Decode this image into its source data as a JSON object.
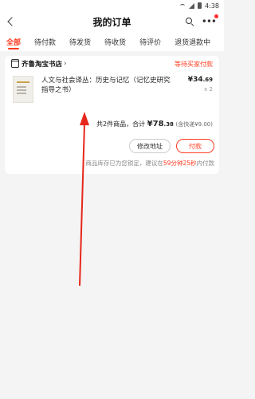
{
  "status_bar": {
    "time": "4:38"
  },
  "nav": {
    "title": "我的订单"
  },
  "tabs": [
    {
      "label": "全部",
      "active": true
    },
    {
      "label": "待付款"
    },
    {
      "label": "待发货"
    },
    {
      "label": "待收货"
    },
    {
      "label": "待评价"
    },
    {
      "label": "退货退款中"
    }
  ],
  "order": {
    "shop_name": "齐鲁淘宝书店",
    "status": "等待买家付款",
    "item": {
      "title": "人文与社会译丛：历史与记忆（记忆史研究指导之书）",
      "price_symbol": "¥",
      "price_int": "34",
      "price_dec": ".69",
      "qty": "x 2"
    },
    "summary": {
      "count_text": "共2件商品，合计",
      "total_symbol": "¥",
      "total_int": "78",
      "total_dec": ".38",
      "shipping": "(含快递¥9.00)"
    },
    "buttons": {
      "modify_address": "修改地址",
      "pay": "付款"
    },
    "stock_note": {
      "prefix": "商品库存已为您锁定，建议在",
      "time": "59分钟25秒",
      "suffix": "内付款"
    }
  },
  "colors": {
    "accent": "#ff3b1f",
    "annotation_arrow": "#e8261b"
  }
}
